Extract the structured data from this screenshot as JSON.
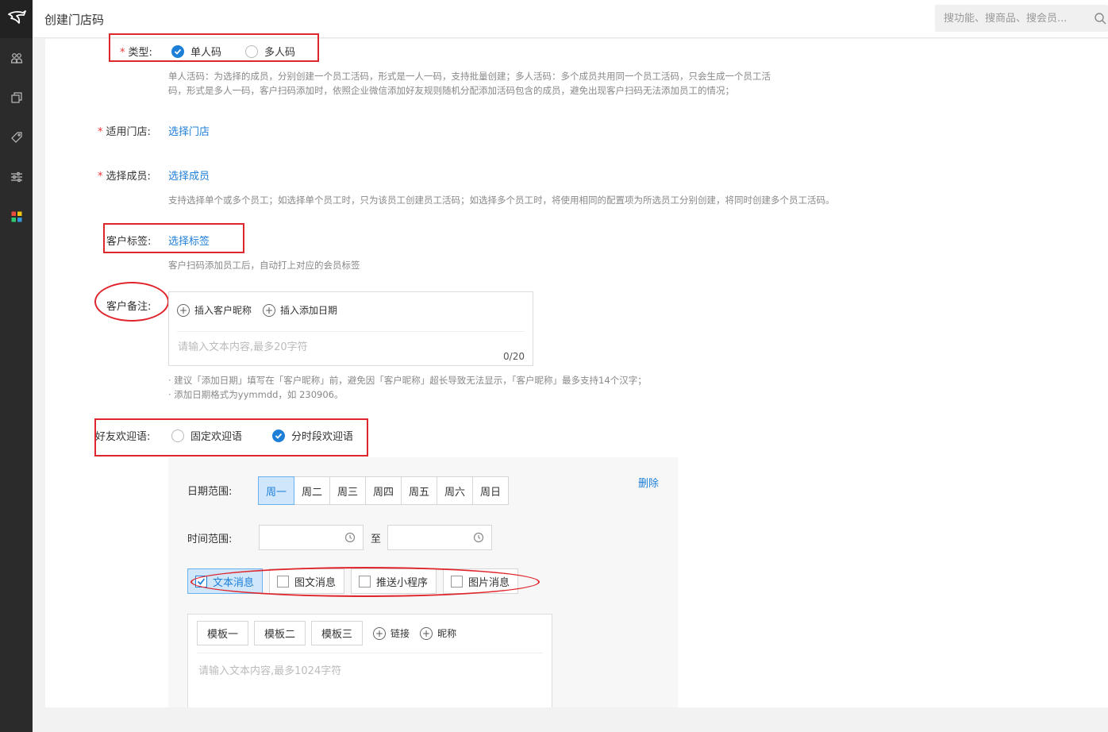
{
  "app": {
    "page_title": "创建门店码"
  },
  "search": {
    "placeholder": "搜功能、搜商品、搜会员..."
  },
  "sidebar": {
    "items": [
      {
        "icon": "users-icon"
      },
      {
        "icon": "copy-icon"
      },
      {
        "icon": "tag-icon"
      },
      {
        "icon": "sliders-icon"
      },
      {
        "icon": "apps-icon"
      }
    ]
  },
  "form": {
    "required_mark": "*",
    "type": {
      "label": "类型:",
      "options": [
        "单人码",
        "多人码"
      ],
      "selected": "单人码",
      "hint_line1": "单人活码：为选择的成员，分别创建一个员工活码，形式是一人一码，支持批量创建；多人活码：多个成员共用同一个员工活码，只会生成一个员工活",
      "hint_line2": "码，形式是多人一码，客户扫码添加时，依照企业微信添加好友规则随机分配添加活码包含的成员，避免出现客户扫码无法添加员工的情况；"
    },
    "store": {
      "label": "适用门店:",
      "action": "选择门店"
    },
    "member": {
      "label": "选择成员:",
      "action": "选择成员",
      "hint": "支持选择单个或多个员工；如选择单个员工时，只为该员工创建员工活码；如选择多个员工时，将使用相同的配置项为所选员工分别创建，将同时创建多个员工活码。"
    },
    "tag": {
      "label": "客户标签:",
      "action": "选择标签",
      "hint": "客户扫码添加员工后，自动打上对应的会员标签"
    },
    "remark": {
      "label": "客户备注:",
      "insert_nickname": "插入客户昵称",
      "insert_date": "插入添加日期",
      "placeholder": "请输入文本内容,最多20字符",
      "counter": "0/20",
      "hint_line1": "· 建议「添加日期」填写在「客户昵称」前，避免因「客户昵称」超长导致无法显示，「客户昵称」最多支持14个汉字；",
      "hint_line2": "· 添加日期格式为yymmdd，如 230906。"
    },
    "welcome": {
      "label": "好友欢迎语:",
      "options": [
        "固定欢迎语",
        "分时段欢迎语"
      ],
      "selected": "分时段欢迎语"
    },
    "period": {
      "date_label": "日期范围:",
      "days": [
        "周一",
        "周二",
        "周三",
        "周四",
        "周五",
        "周六",
        "周日"
      ],
      "selected_day": "周一",
      "delete": "删除",
      "time_label": "时间范围:",
      "to": "至",
      "message_types": [
        "文本消息",
        "图文消息",
        "推送小程序",
        "图片消息"
      ],
      "selected_type": "文本消息",
      "templates": [
        "模板一",
        "模板二",
        "模板三"
      ],
      "insert_link": "链接",
      "insert_nick": "昵称",
      "text_placeholder": "请输入文本内容,最多1024字符"
    }
  },
  "colors": {
    "primary": "#1e7fd8",
    "annotation": "#e0262d",
    "sidebar": "#2b2b2b"
  }
}
